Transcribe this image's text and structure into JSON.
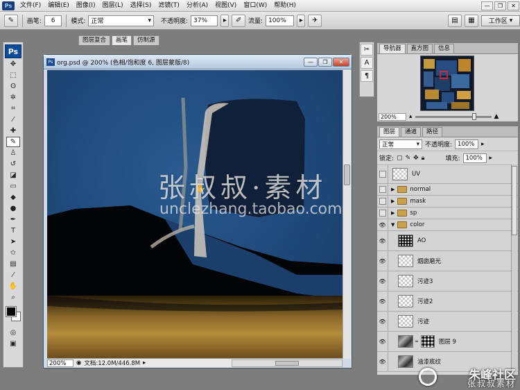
{
  "app": {
    "logo": "Ps"
  },
  "menubar": {
    "items": [
      "文件(F)",
      "编辑(E)",
      "图像(I)",
      "图层(L)",
      "选择(S)",
      "滤镜(T)",
      "分析(A)",
      "视图(V)",
      "窗口(W)",
      "帮助(H)"
    ],
    "window_controls": [
      "—",
      "❐",
      "✕"
    ]
  },
  "options_bar": {
    "brush_label": "画笔:",
    "brush_size": "6",
    "mode_label": "模式:",
    "mode_value": "正常",
    "opacity_label": "不透明度:",
    "opacity_value": "37%",
    "flow_label": "流量:",
    "flow_value": "100%",
    "workspace_label": "工作区"
  },
  "mid_tabs": [
    "图层复合",
    "画笔",
    "仿制源"
  ],
  "document": {
    "title": "org.psd @ 200% (色相/饱和度 6, 图层蒙版/8)",
    "zoom": "200%",
    "doc_info": "文档:12.0M/446.8M"
  },
  "navigator": {
    "tabs": [
      "导航器",
      "直方图",
      "信息"
    ],
    "zoom": "200%"
  },
  "layers_panel": {
    "tabs": [
      "图层",
      "通道",
      "路径"
    ],
    "blend_mode": "正常",
    "opacity_label": "不透明度:",
    "opacity_value": "100%",
    "lock_label": "锁定:",
    "fill_label": "填充:",
    "fill_value": "100%",
    "layers": [
      {
        "name": "UV",
        "kind": "layer",
        "visible": false
      },
      {
        "name": "normal",
        "kind": "group",
        "visible": false
      },
      {
        "name": "mask",
        "kind": "group",
        "visible": false
      },
      {
        "name": "sp",
        "kind": "group",
        "visible": false
      },
      {
        "name": "color",
        "kind": "group-open",
        "visible": true
      },
      {
        "name": "AO",
        "kind": "layer",
        "visible": true
      },
      {
        "name": "烟囱磨光",
        "kind": "layer",
        "visible": true
      },
      {
        "name": "污迹3",
        "kind": "layer",
        "visible": true
      },
      {
        "name": "污迹2",
        "kind": "layer",
        "visible": true
      },
      {
        "name": "污迹",
        "kind": "layer",
        "visible": true
      },
      {
        "name": "图层 9",
        "kind": "layer",
        "visible": true
      },
      {
        "name": "油漆底纹",
        "kind": "layer",
        "visible": true
      }
    ]
  },
  "watermark": {
    "line1": "张叔叔·素材",
    "line2": "unclezhang.taobao.com"
  },
  "corner_watermark": {
    "line1": "朱峰社区",
    "line2": "张叔叔素材"
  },
  "colors": {
    "fg": "#000000",
    "bg": "#ffffff",
    "canvas_blue": "#1e4c82"
  }
}
